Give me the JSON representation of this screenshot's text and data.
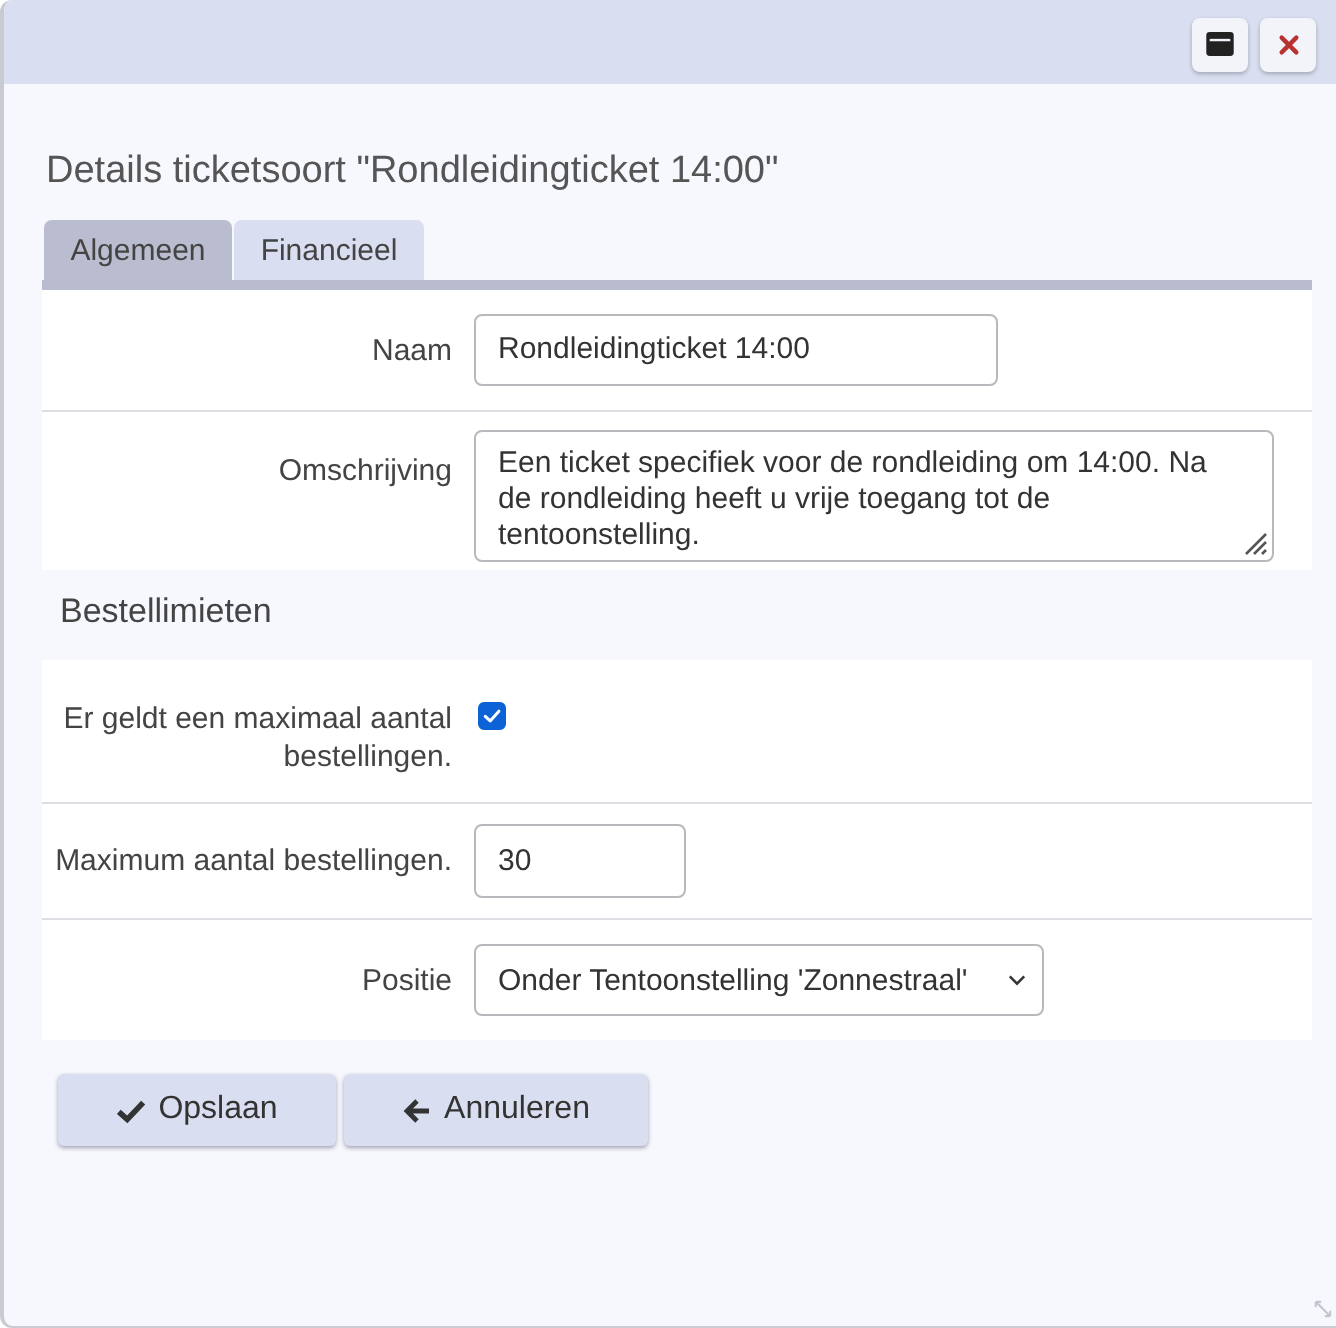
{
  "window": {
    "title": "Details ticketsoort \"Rondleidingticket 14:00\""
  },
  "header_buttons": [
    {
      "kind": "maximize"
    },
    {
      "kind": "close"
    }
  ],
  "tabs": [
    {
      "label": "Algemeen",
      "selected": true
    },
    {
      "label": "Financieel",
      "selected": false
    }
  ],
  "general_fields": [
    {
      "kind": "text",
      "label": "Naam",
      "value": "Rondleidingticket 14:00"
    },
    {
      "kind": "textarea",
      "label": "Omschrijving",
      "value": "Een ticket specifiek voor de rondleiding om 14:00. Na de rondleiding heeft u vrije toegang tot de tentoonstelling."
    }
  ],
  "order_limits": {
    "heading": "Bestellimieten",
    "fields": [
      {
        "kind": "checkbox",
        "label": "Er geldt een maximaal aantal bestellingen.",
        "checked": true
      },
      {
        "kind": "number",
        "label": "Maximum aantal bestellingen.",
        "value": "30"
      },
      {
        "kind": "select",
        "label": "Positie",
        "value": "Onder Tentoonstelling 'Zonnestraal'"
      }
    ]
  },
  "actions": [
    {
      "kind": "save",
      "label": "Opslaan"
    },
    {
      "kind": "cancel",
      "label": "Annuleren"
    }
  ]
}
